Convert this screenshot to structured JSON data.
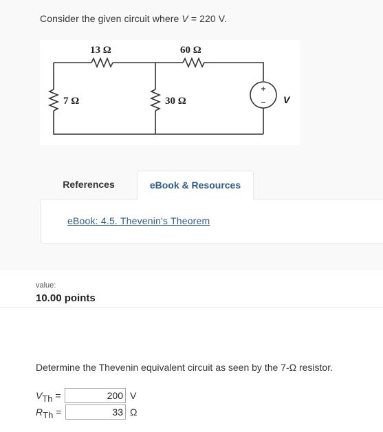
{
  "problem": {
    "intro_prefix": "Consider the given circuit where ",
    "intro_var": "V",
    "intro_suffix": " = 220 V."
  },
  "circuit": {
    "resistors": [
      {
        "id": "r1",
        "label": "13 Ω"
      },
      {
        "id": "r2",
        "label": "60 Ω"
      },
      {
        "id": "r3",
        "label": "7 Ω"
      },
      {
        "id": "r4",
        "label": "30 Ω"
      }
    ],
    "source": {
      "label": "V",
      "plus": "+",
      "minus": "−"
    }
  },
  "tabs": [
    {
      "label": "References",
      "active": false
    },
    {
      "label": "eBook & Resources",
      "active": true
    }
  ],
  "panel": {
    "link_text": "eBook: 4.5. Thevenin's Theorem"
  },
  "score": {
    "label": "value:",
    "points": "10.00 points"
  },
  "question": {
    "text": "Determine the Thevenin equivalent circuit as seen by the 7-Ω resistor."
  },
  "answers": {
    "vth": {
      "symbol": "V",
      "subscript": "Th",
      "equals": "=",
      "value": "200",
      "unit": "V"
    },
    "rth": {
      "symbol": "R",
      "subscript": "Th",
      "equals": "=",
      "value": "33",
      "unit": "Ω"
    }
  }
}
